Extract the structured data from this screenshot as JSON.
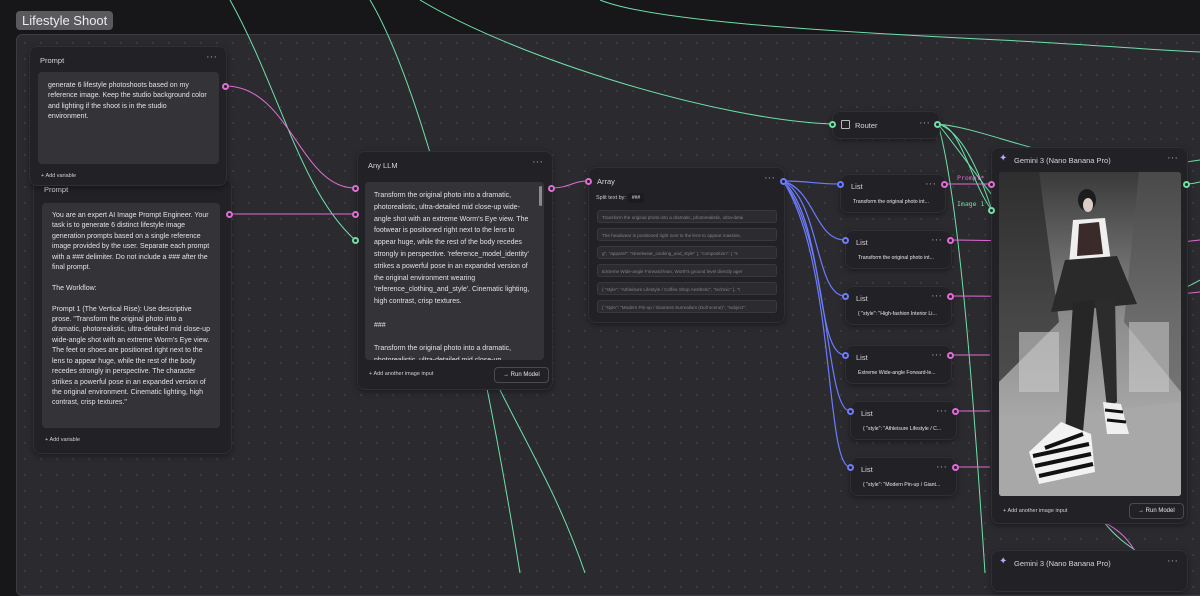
{
  "group": {
    "title": "Lifestyle Shoot"
  },
  "prompt_node": {
    "title": "Prompt",
    "menu": "···",
    "text": "generate 6 lifestyle photoshoots based on my reference image. Keep the studio background color and lighting if the shoot is in the studio environment.",
    "add_variable": "Add variable"
  },
  "prompt_node_2": {
    "title": "Prompt",
    "text": "You are an expert AI Image Prompt Engineer. Your task is to generate 6 distinct lifestyle image generation prompts based on a single reference image provided by the user. Separate each prompt with a ### delimiter. Do not include a ### after the final prompt.\n\nThe Workflow:\n\nPrompt 1 (The Vertical Rise): Use descriptive prose. \"Transform the original photo into a dramatic, photorealistic, ultra-detailed mid close-up wide-angle shot with an extreme Worm's Eye view. The feet or shoes are positioned right next to the lens to appear huge, while the rest of the body recedes strongly in perspective. The character strikes a powerful pose in an expanded version of the original environment. Cinematic lighting, high contrast, crisp textures.\"",
    "add_variable": "Add variable"
  },
  "llm_node": {
    "title": "Any LLM",
    "menu": "···",
    "text": "Transform the original photo into a dramatic, photorealistic, ultra-detailed mid close-up wide-angle shot with an extreme Worm's Eye view. The footwear is positioned right next to the lens to appear huge, while the rest of the body recedes strongly in perspective. 'reference_model_identity' strikes a powerful pose in an expanded version of the original environment wearing 'reference_clothing_and_style'. Cinematic lighting, high contrast, crisp textures.\n\n###\n\nTransform the original photo into a dramatic, photorealistic, ultra-detailed mid close-up",
    "add_image": "Add another image input",
    "run": "Run Model"
  },
  "array_node": {
    "title": "Array",
    "menu": "···",
    "split_label": "Split text by:",
    "split_value": "###",
    "rows": [
      "Transform the original photo into a dramatic, photorealistic, ultra-detai",
      "The headwear is positioned right next to the lens to appear massive,",
      "g\",   \"apparel\": \"streetwear_cooking_and_style\" }, \"composition\": {  \"s",
      "Extreme Wide-angle Forward-lean, Worth's ground level directly ager",
      "{  \"style\": \"Athleisure Lifestyle / Coffee Shop Aesthetic\",  \"technic\" },  \"t",
      "{  \"style\": \"Modern Pin-up / Giantess Surrealism (Doll scene)\",  \"subject\":"
    ]
  },
  "router_node": {
    "title": "Router",
    "menu": "···"
  },
  "list_nodes": [
    {
      "title": "List",
      "value": "Transform the original photo int..."
    },
    {
      "title": "List",
      "value": "Transform the original photo int..."
    },
    {
      "title": "List",
      "value": "{  \"style\": \"High-fashion Interior Li..."
    },
    {
      "title": "List",
      "value": "Extreme Wide-angle Forward-le..."
    },
    {
      "title": "List",
      "value": "{  \"style\": \"Athleisure Lifestyle / C..."
    },
    {
      "title": "List",
      "value": "{  \"style\": \"Modern Pin-up / Giant..."
    }
  ],
  "list_menu": "···",
  "gemini_node": {
    "title": "Gemini 3 (Nano Banana Pro)",
    "menu": "···",
    "add_image": "Add another image input",
    "run": "Run Model"
  },
  "gemini_node_2": {
    "title": "Gemini 3 (Nano Banana Pro)",
    "menu": "···"
  },
  "edge_labels": {
    "prompt": "Prompt*",
    "image": "Image 1"
  },
  "colors": {
    "text_edge": "#e06cd4",
    "image_edge": "#6fe0a8",
    "list_edge": "#6d7bff",
    "canvas": "#17171a",
    "group_bg": "#2b2b2f"
  }
}
